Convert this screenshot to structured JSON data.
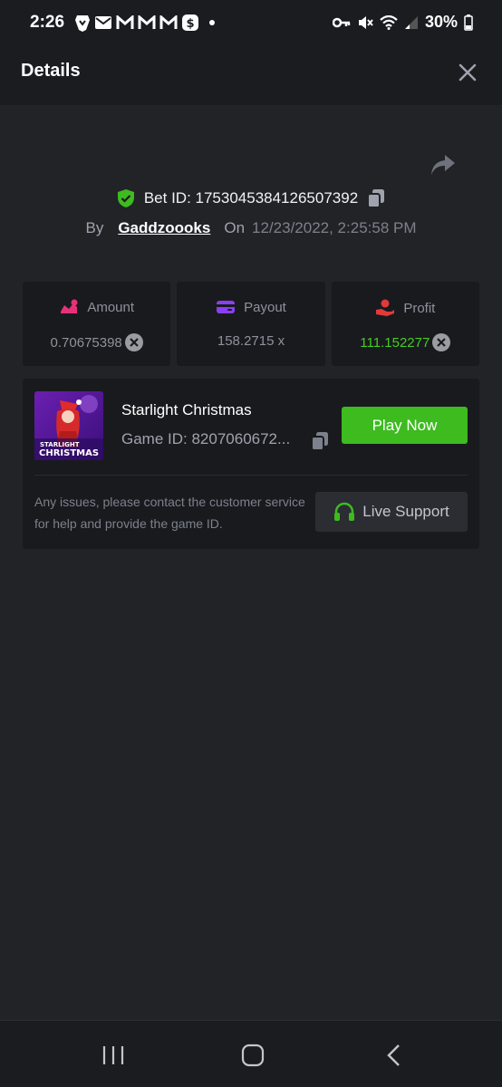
{
  "status_bar": {
    "time": "2:26",
    "battery": "30%"
  },
  "header": {
    "title": "Details"
  },
  "bet": {
    "bet_id_label": "Bet ID: 1753045384126507392",
    "by_label": "By",
    "username": "Gaddzoooks",
    "on_label": "On",
    "date": "12/23/2022, 2:25:58 PM"
  },
  "stats": [
    {
      "label": "Amount",
      "value": "0.70675398",
      "icon": "amount-icon"
    },
    {
      "label": "Payout",
      "value": "158.2715 x",
      "icon": "wallet-icon"
    },
    {
      "label": "Profit",
      "value": "111.152277",
      "icon": "profit-icon"
    }
  ],
  "game": {
    "thumb_line1": "STARLIGHT",
    "thumb_line2": "CHRISTMAS",
    "name": "Starlight Christmas",
    "game_id": "Game ID: 8207060672...",
    "play_label": "Play Now",
    "note": "Any issues, please contact the customer service for help and provide the game ID.",
    "support_label": "Live Support"
  },
  "colors": {
    "accent_green": "#3dbb1f",
    "profit_green": "#44cc22",
    "amount_pink": "#e8307a",
    "payout_purple": "#8a3ff0",
    "profit_red": "#e03a3a",
    "background": "#222327",
    "card": "#191a1e"
  }
}
